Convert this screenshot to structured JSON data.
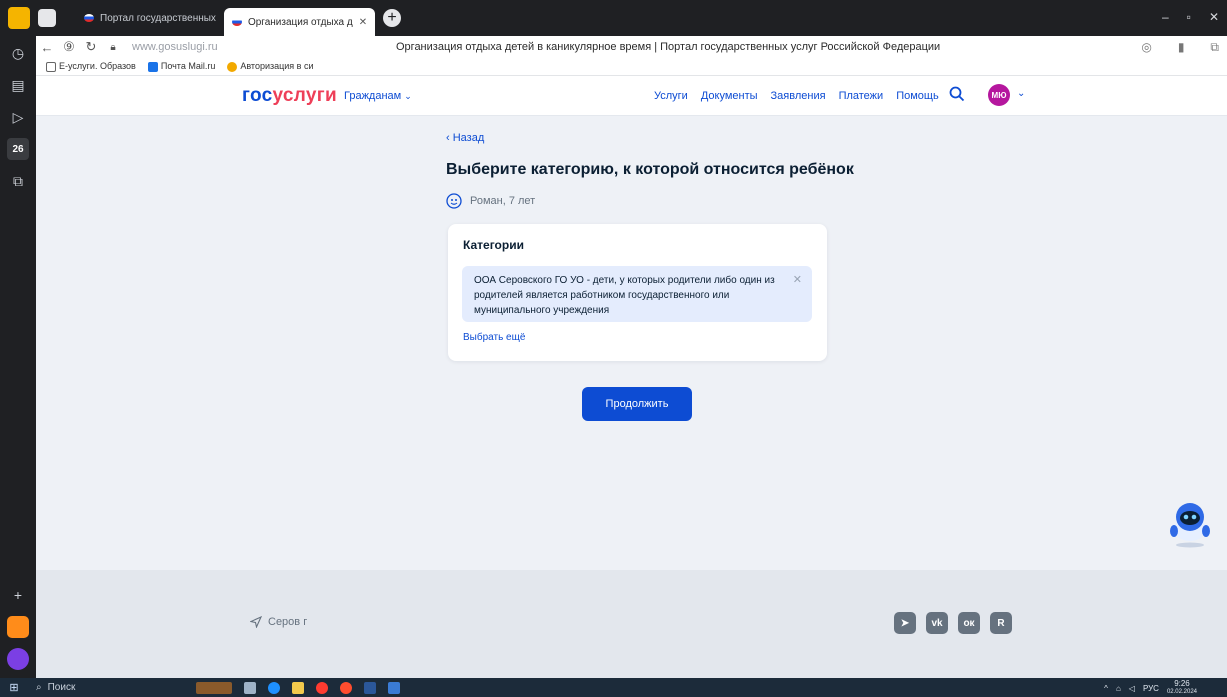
{
  "browser": {
    "tabs": [
      {
        "label": "Портал государственных"
      },
      {
        "label": "Организация отдыха д"
      }
    ],
    "url": "www.gosuslugi.ru",
    "page_title": "Организация отдыха детей в каникулярное время | Портал государственных услуг Российской Федерации",
    "bookmarks": [
      {
        "label": "Е-услуги. Образов"
      },
      {
        "label": "Почта Mail.ru"
      },
      {
        "label": "Авторизация в си"
      }
    ],
    "sidebar_badge": "26"
  },
  "site": {
    "logo_part1": "гос",
    "logo_part2": "услуги",
    "citizens_label": "Гражданам",
    "nav": [
      {
        "label": "Услуги"
      },
      {
        "label": "Документы"
      },
      {
        "label": "Заявления"
      },
      {
        "label": "Платежи"
      },
      {
        "label": "Помощь"
      }
    ],
    "avatar_initials": "МЮ"
  },
  "main": {
    "back_label": "Назад",
    "title": "Выберите категорию, к которой относится ребёнок",
    "child_label": "Роман, 7 лет",
    "card": {
      "title": "Категории",
      "selected_category": "ООА Серовского ГО УО - дети, у которых родители либо один из родителей является работником государственного или муниципального учреждения",
      "more_label": "Выбрать ещё"
    },
    "continue_label": "Продолжить"
  },
  "footer": {
    "location": "Серов г",
    "socials": [
      "telegram",
      "vk",
      "odnoklassniki",
      "rutube"
    ]
  },
  "taskbar": {
    "search_label": "Поиск",
    "lang": "РУС",
    "time": "9:26",
    "date": "02.02.2024"
  },
  "colors": {
    "brand_blue": "#0d4cd3",
    "brand_red": "#ee3f58",
    "chip_bg": "#e4ecfd",
    "page_bg": "#eef1f6",
    "avatar": "#b5179e"
  }
}
